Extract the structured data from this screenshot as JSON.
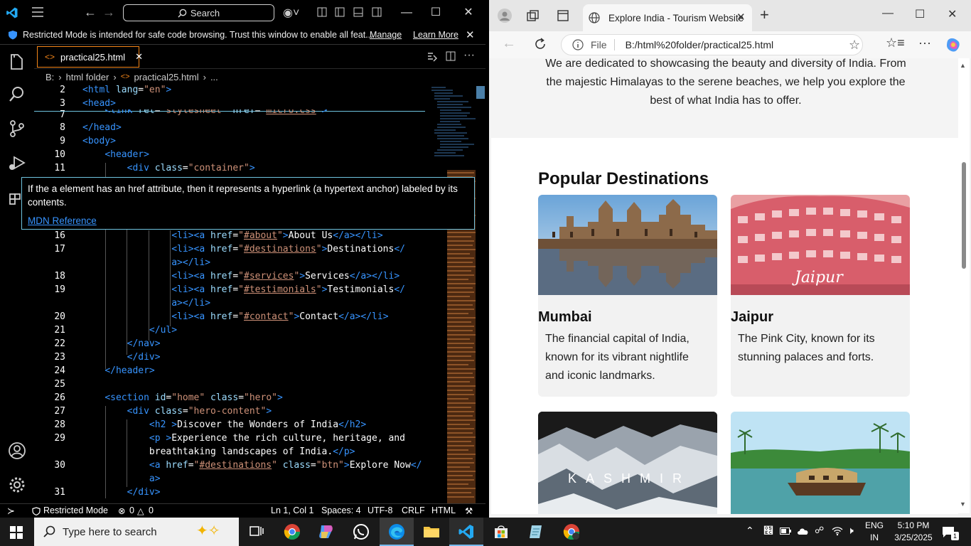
{
  "vscode": {
    "search_label": "Search",
    "banner": {
      "text": "Restricted Mode is intended for safe code browsing. Trust this window to enable all feat...",
      "manage": "Manage",
      "learn_more": "Learn More"
    },
    "tab": {
      "label": "practical25.html"
    },
    "breadcrumb": {
      "drive": "B:",
      "folder": "html folder",
      "file": "practical25.html",
      "more": "..."
    },
    "hover": {
      "text": "If the a element has an href attribute, then it represents a hyperlink (a hypertext anchor) labeled by its contents.",
      "link": "MDN Reference"
    },
    "lines": [
      "2",
      "3",
      "7",
      "8",
      "9",
      "10",
      "11",
      "16",
      "17",
      "",
      "18",
      "19",
      "",
      "20",
      "21",
      "22",
      "23",
      "24",
      "25",
      "26",
      "27",
      "28",
      "29",
      "",
      "30",
      "",
      "31"
    ],
    "status": {
      "mode": "Restricted Mode",
      "problems": "0",
      "warnings": "0",
      "position": "Ln 1, Col 1",
      "spaces": "Spaces: 4",
      "encoding": "UTF-8",
      "eol": "CRLF",
      "language": "HTML"
    }
  },
  "browser": {
    "tab_title": "Explore India - Tourism Website",
    "url_prefix": "File",
    "url": "B:/html%20folder/practical25.html",
    "about_text": "We are dedicated to showcasing the beauty and diversity of India. From the majestic Himalayas to the serene beaches, we help you explore the best of what India has to offer.",
    "section_title": "Popular Destinations",
    "cards": [
      {
        "title": "Mumbai",
        "text": "The financial capital of India, known for its vibrant nightlife and iconic landmarks."
      },
      {
        "title": "Jaipur",
        "text": "The Pink City, known for its stunning palaces and forts.",
        "img_caption": "Jaipur"
      },
      {
        "title": "",
        "text": "",
        "img_caption": "KASHMIR"
      },
      {
        "title": "",
        "text": ""
      }
    ]
  },
  "taskbar": {
    "search": "Type here to search",
    "lang": "ENG",
    "region": "IN",
    "time": "5:10 PM",
    "date": "3/25/2025",
    "notification": "1"
  }
}
